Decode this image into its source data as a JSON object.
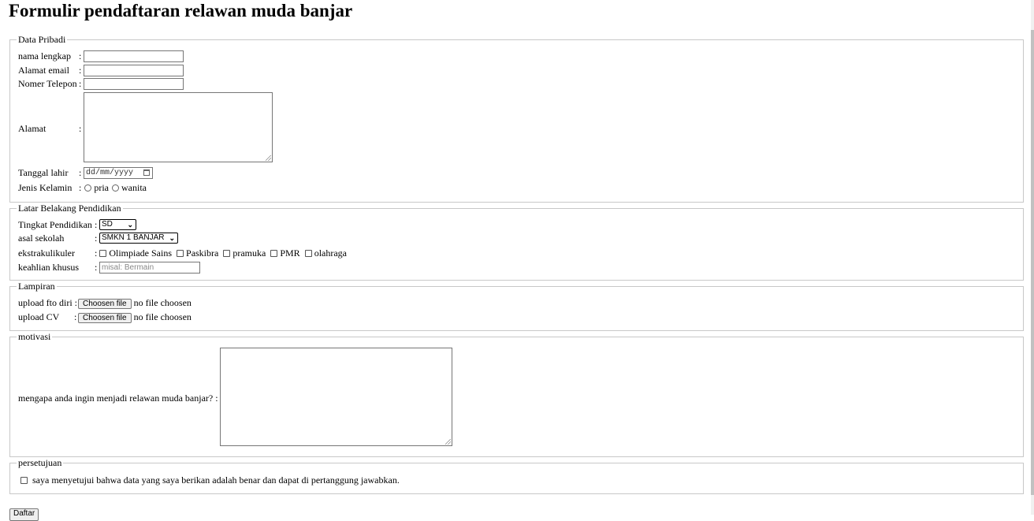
{
  "page": {
    "title": "Formulir pendaftaran relawan muda banjar"
  },
  "pribadi": {
    "legend": "Data Pribadi",
    "nama_label": "nama lengkap",
    "email_label": "Alamat email",
    "telp_label": "Nomer Telepon",
    "alamat_label": "Alamat",
    "lahir_label": "Tanggal lahir",
    "lahir_placeholder": "dd/mm/yyyy",
    "kelamin_label": "Jenis Kelamin",
    "pria_label": "pria",
    "wanita_label": "wanita",
    "colon": ":"
  },
  "pendidikan": {
    "legend": "Latar Belakang Pendidikan",
    "tingkat_label": "Tingkat Pendidikan",
    "tingkat_value": "SD",
    "asal_label": "asal sekolah",
    "asal_value": "SMKN 1 BANJAR",
    "ekskul_label": "ekstrakulikuler",
    "ekskul": [
      "Olimpiade Sains",
      "Paskibra",
      "pramuka",
      "PMR",
      "olahraga"
    ],
    "keahlian_label": "keahlian khusus",
    "keahlian_placeholder": "misal: Bermain musik,seni,d"
  },
  "lampiran": {
    "legend": "Lampiran",
    "foto_label": "upload fto diri",
    "cv_label": "upload CV",
    "button": "Choosen file",
    "status": "no file choosen"
  },
  "motivasi": {
    "legend": "motivasi",
    "question": "mengapa anda ingin menjadi relawan muda banjar?"
  },
  "persetujuan": {
    "legend": "persetujuan",
    "text": "saya menyetujui bahwa data yang saya berikan adalah benar dan dapat di pertanggung jawabkan."
  },
  "submit": {
    "label": "Daftar"
  }
}
